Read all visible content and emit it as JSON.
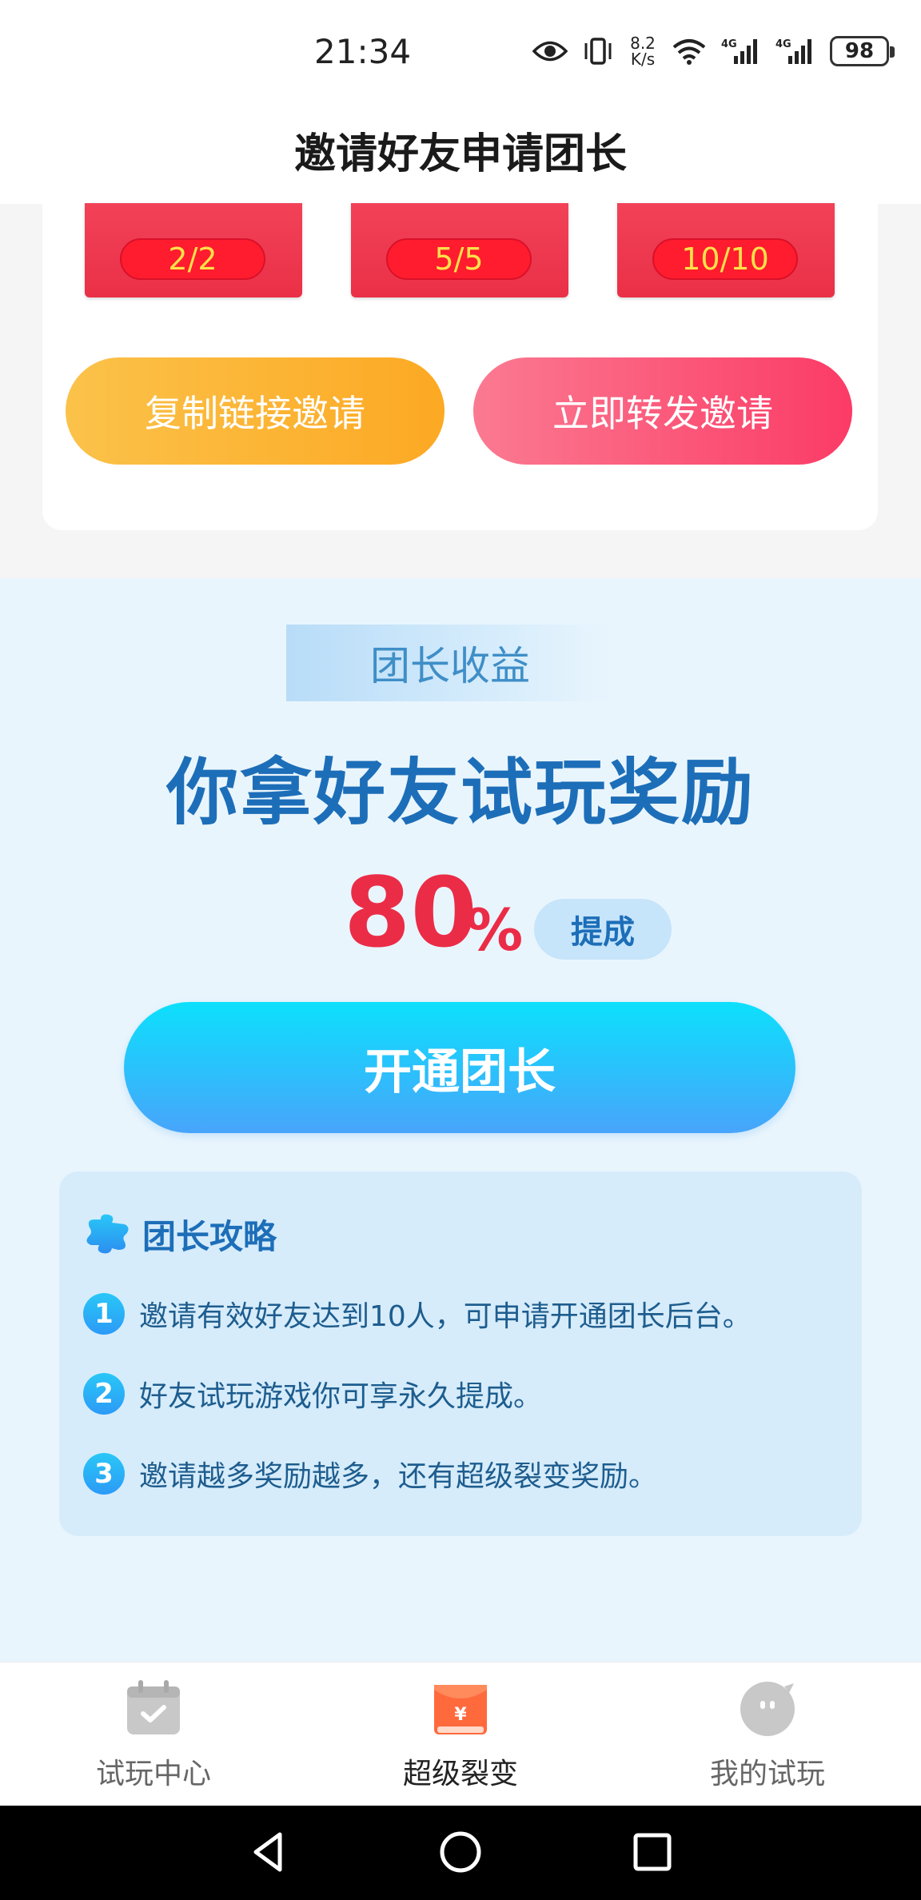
{
  "status_bar": {
    "time": "21:34",
    "net_speed_value": "8.2",
    "net_speed_unit": "K/s",
    "signal1_label": "4G",
    "signal2_label": "4G",
    "battery": "98",
    "icons": [
      "eye-icon",
      "vibrate-icon",
      "wifi-icon",
      "signal-icon",
      "signal-icon",
      "battery-icon"
    ]
  },
  "header": {
    "title": "邀请好友申请团长"
  },
  "invite_card": {
    "milestones": [
      {
        "progress": "2/2"
      },
      {
        "progress": "5/5"
      },
      {
        "progress": "10/10"
      }
    ],
    "copy_button": "复制链接邀请",
    "share_button": "立即转发邀请"
  },
  "leader": {
    "tag": "团长收益",
    "headline": "你拿好友试玩奖励",
    "rate_value": "80",
    "rate_unit": "%",
    "rate_badge": "提成",
    "open_button": "开通团长",
    "guide": {
      "title": "团长攻略",
      "items": [
        {
          "num": "1",
          "text": "邀请有效好友达到10人，可申请开通团长后台。"
        },
        {
          "num": "2",
          "text": "好友试玩游戏你可享永久提成。"
        },
        {
          "num": "3",
          "text": "邀请越多奖励越多，还有超级裂变奖励。"
        }
      ]
    }
  },
  "bottom_nav": {
    "items": [
      {
        "label": "试玩中心",
        "icon": "calendar-check-icon",
        "active": false
      },
      {
        "label": "超级裂变",
        "icon": "red-envelope-icon",
        "active": true
      },
      {
        "label": "我的试玩",
        "icon": "chat-bubble-icon",
        "active": false
      }
    ]
  },
  "colors": {
    "accent_blue": "#1d6eb8",
    "accent_red": "#eb2c47",
    "copy_orange": "#fca923",
    "share_pink": "#fb3b66"
  }
}
